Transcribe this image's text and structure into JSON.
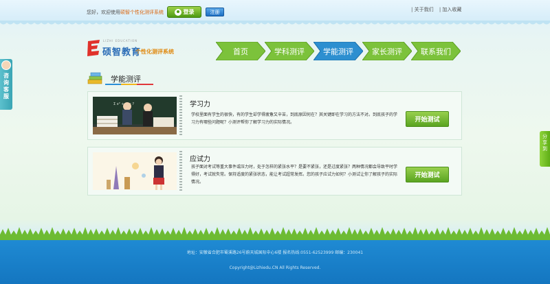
{
  "topbar": {
    "welcome_prefix": "您好，欢迎使用",
    "welcome_brand": "硕智个性化测评系统",
    "login_label": "登录",
    "register_label": "注册",
    "link_about": "| 关于我们",
    "link_favorite": "| 加入收藏"
  },
  "logo": {
    "edu_text": "LIZHI EDUCATION",
    "name": "硕智教育",
    "tagline": "个性化测评系统"
  },
  "nav": {
    "items": [
      "首页",
      "学科测评",
      "学能测评",
      "家长测评",
      "联系我们"
    ],
    "active_index": 2,
    "colors": {
      "normal": "#7cc23b",
      "active": "#2d8fd0"
    }
  },
  "side": {
    "consult_label": "咨询客服",
    "share_label": "分享到"
  },
  "section": {
    "title": "学能测评"
  },
  "cards": [
    {
      "title": "学习力",
      "description": "学校里面有学生的很快，有的学生却学得疲惫又辛苦，到底原因何在？其关键即在学习的方法不对。到底孩子的学习力有哪些问题呢？小测评帮你了解学习力的实际情况。",
      "button": "开始测试"
    },
    {
      "title": "应试力",
      "description": "孩子面对考试等重大事件或压力时，处于怎样的紧张水平？是要不紧张，还是过度紧张？两种情况都会导致平时学得好，考试就失常。保持适度的紧张状态，能让考试超常发挥。您的孩子应试力如何？小测试让你了解孩子的实际情况。",
      "button": "开始测试"
    }
  ],
  "footer": {
    "address": "地址：安徽省合肥市蜀溪路26号蔚天城国际中心6楼 报名热线:0551-62523999 邮编：230041",
    "copyright": "Copyright@Lizhiedu.CN All Rights Reserved."
  }
}
